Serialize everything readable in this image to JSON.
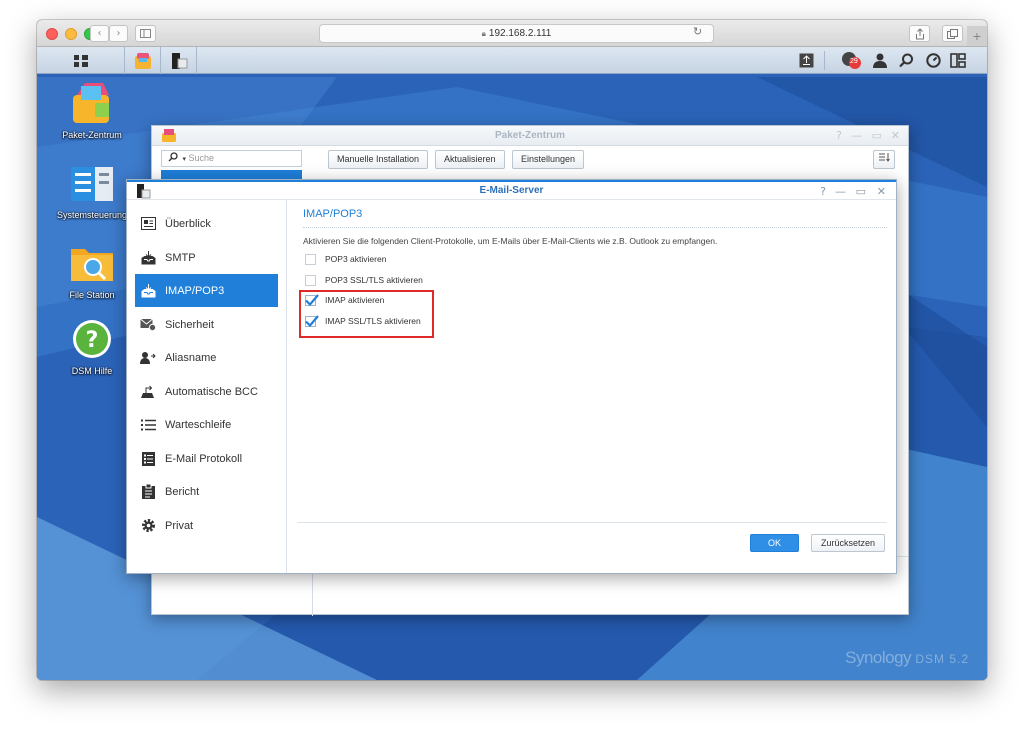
{
  "browser": {
    "url": "192.168.2.111",
    "reload_glyph": "↻"
  },
  "desktop": {
    "icons": [
      {
        "label": "Paket-Zentrum",
        "icon": "package-center-icon"
      },
      {
        "label": "Systemsteuerung",
        "icon": "control-panel-icon"
      },
      {
        "label": "File Station",
        "icon": "file-station-icon"
      },
      {
        "label": "DSM Hilfe",
        "icon": "help-icon"
      }
    ],
    "notification_count": "29",
    "brand": "Synology",
    "brand_version": "DSM 5.2"
  },
  "package_center": {
    "title": "Paket-Zentrum",
    "search_placeholder": "Suche",
    "buttons": [
      "Manuelle Installation",
      "Aktualisieren",
      "Einstellungen"
    ]
  },
  "mail_server": {
    "title": "E-Mail-Server",
    "sidebar": [
      {
        "label": "Überblick",
        "icon": "overview-icon",
        "active": false
      },
      {
        "label": "SMTP",
        "icon": "inbox-icon",
        "active": false
      },
      {
        "label": "IMAP/POP3",
        "icon": "inbox-icon",
        "active": true
      },
      {
        "label": "Sicherheit",
        "icon": "security-mail-icon",
        "active": false
      },
      {
        "label": "Aliasname",
        "icon": "alias-user-icon",
        "active": false
      },
      {
        "label": "Automatische BCC",
        "icon": "auto-bcc-icon",
        "active": false
      },
      {
        "label": "Warteschleife",
        "icon": "queue-list-icon",
        "active": false
      },
      {
        "label": "E-Mail Protokoll",
        "icon": "log-icon",
        "active": false
      },
      {
        "label": "Bericht",
        "icon": "report-clipboard-icon",
        "active": false
      },
      {
        "label": "Privat",
        "icon": "gear-icon",
        "active": false
      }
    ],
    "section_title": "IMAP/POP3",
    "description": "Aktivieren Sie die folgenden Client-Protokolle, um E-Mails über E-Mail-Clients wie z.B. Outlook zu empfangen.",
    "options": [
      {
        "label": "POP3 aktivieren",
        "checked": false
      },
      {
        "label": "POP3 SSL/TLS aktivieren",
        "checked": false
      },
      {
        "label": "IMAP aktivieren",
        "checked": true
      },
      {
        "label": "IMAP SSL/TLS aktivieren",
        "checked": true
      }
    ],
    "ok_label": "OK",
    "reset_label": "Zurücksetzen"
  },
  "colors": {
    "accent": "#1f7fd9",
    "highlight_border": "#e02a2a",
    "desktop_bg": "#2b63b8"
  }
}
